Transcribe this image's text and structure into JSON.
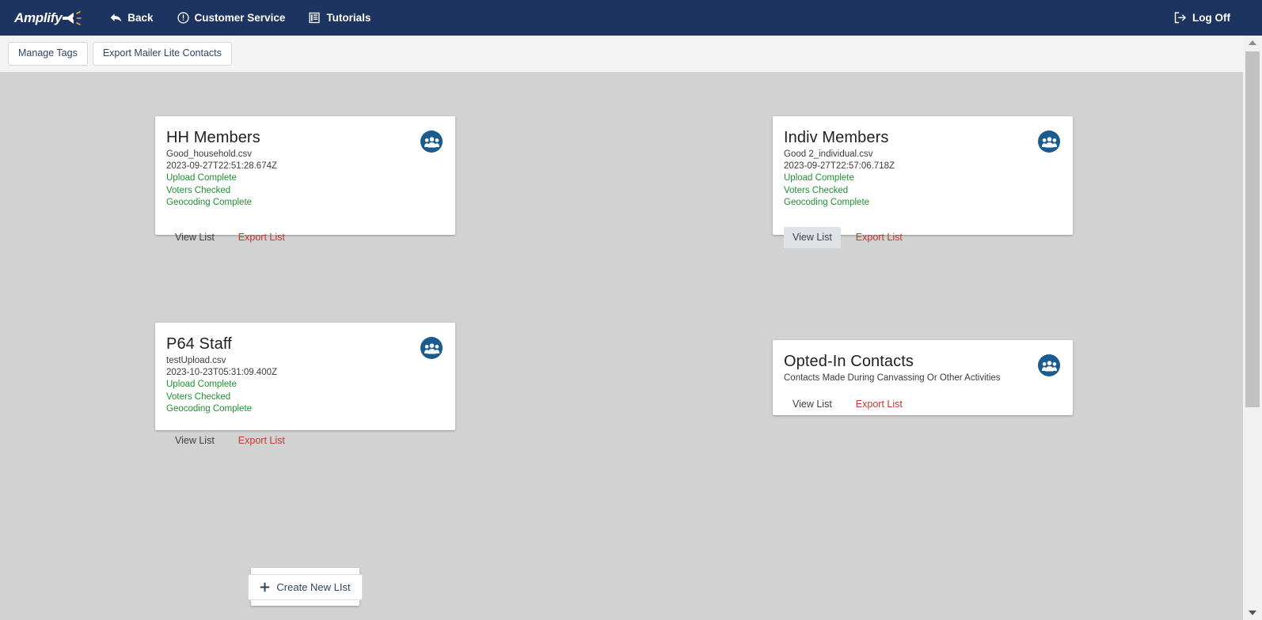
{
  "navbar": {
    "brand": "Amplify",
    "brand_icon": "megaphone-icon",
    "items": [
      {
        "label": "Back",
        "icon": "back-arrow-icon"
      },
      {
        "label": "Customer Service",
        "icon": "exclamation-circle-icon"
      },
      {
        "label": "Tutorials",
        "icon": "book-icon"
      }
    ],
    "logoff": {
      "label": "Log Off",
      "icon": "logout-icon"
    },
    "background_color": "#1d3460"
  },
  "toolbar": {
    "buttons": [
      {
        "label": "Manage Tags"
      },
      {
        "label": "Export Mailer Lite Contacts"
      }
    ]
  },
  "colors": {
    "accent_navy": "#1d3460",
    "status_green": "#1f9130",
    "export_red": "#c0392b",
    "avatar_blue": "#1a5b90",
    "canvas_gray": "#d2d2d2",
    "toolbar_gray": "#f4f4f4"
  },
  "cards": [
    {
      "title": "HH Members",
      "file": "Good_household.csv",
      "timestamp": "2023-09-27T22:51:28.674Z",
      "description": "",
      "statuses": [
        "Upload Complete",
        "Voters Checked",
        "Geocoding Complete"
      ],
      "view_label": "View List",
      "export_label": "Export List",
      "icon": "group-people-icon",
      "view_focused": false
    },
    {
      "title": "Indiv Members",
      "file": "Good 2_individual.csv",
      "timestamp": "2023-09-27T22:57:06.718Z",
      "description": "",
      "statuses": [
        "Upload Complete",
        "Voters Checked",
        "Geocoding Complete"
      ],
      "view_label": "View List",
      "export_label": "Export List",
      "icon": "group-people-icon",
      "view_focused": true
    },
    {
      "title": "P64 Staff",
      "file": "testUpload.csv",
      "timestamp": "2023-10-23T05:31:09.400Z",
      "description": "",
      "statuses": [
        "Upload Complete",
        "Voters Checked",
        "Geocoding Complete"
      ],
      "view_label": "View List",
      "export_label": "Export List",
      "icon": "group-people-icon",
      "view_focused": false
    },
    {
      "title": "Opted-In Contacts",
      "file": "",
      "timestamp": "",
      "description": "Contacts Made During Canvassing Or Other Activities",
      "statuses": [],
      "view_label": "View List",
      "export_label": "Export List",
      "icon": "group-people-icon",
      "view_focused": false
    }
  ],
  "create_panel": {
    "button_label": "Create New LIst",
    "icon": "plus-icon"
  },
  "scrollbar": {
    "up_icon": "triangle-up-icon",
    "down_icon": "triangle-down-icon"
  }
}
